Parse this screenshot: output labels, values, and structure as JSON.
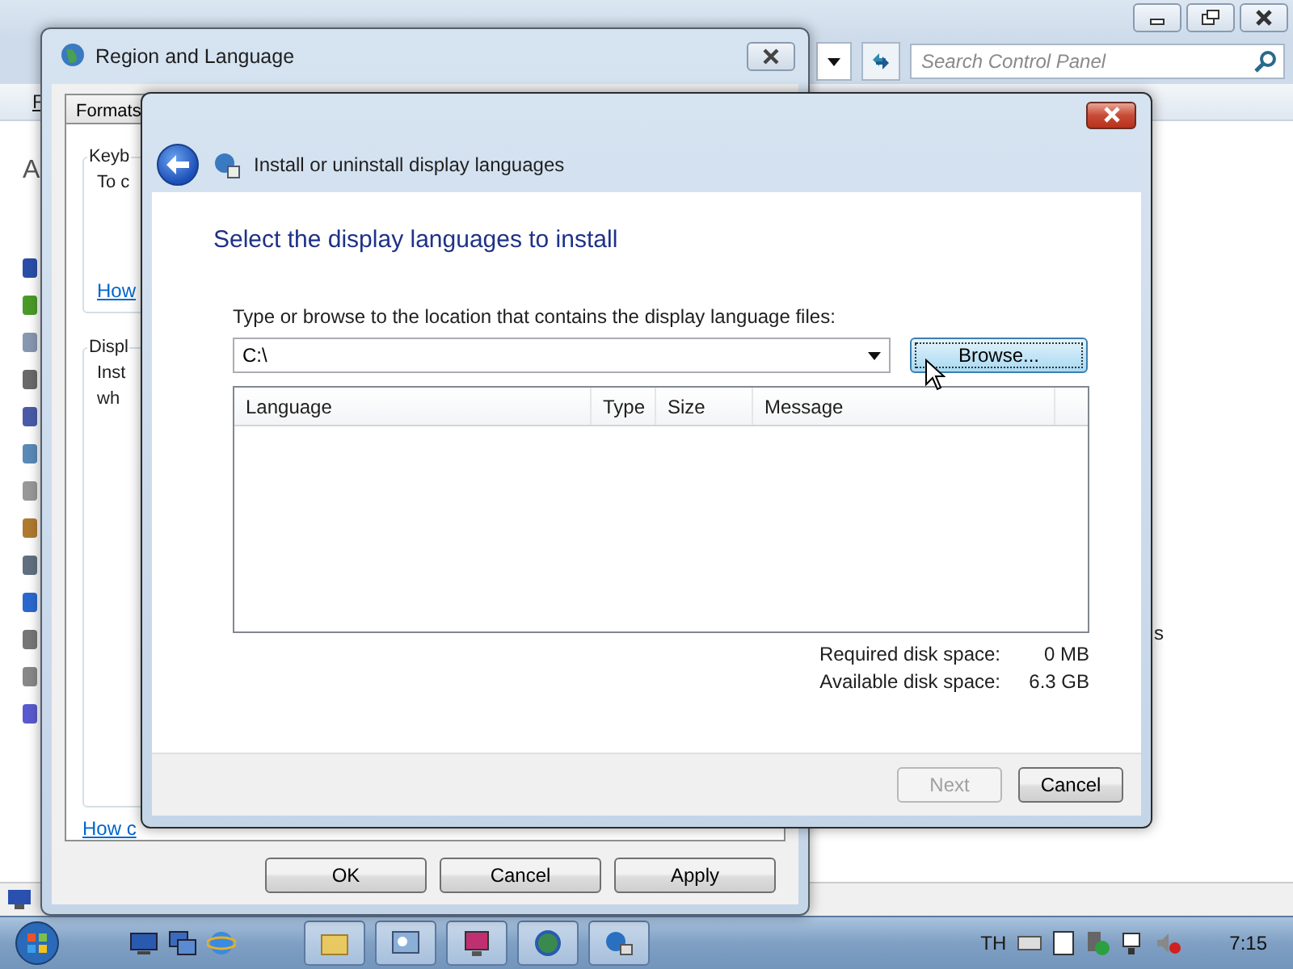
{
  "control_panel": {
    "search": {
      "placeholder": "Search Control Panel"
    },
    "menu_partial": "F",
    "content_partial": "A",
    "right_partial": "s"
  },
  "region_window": {
    "title": "Region and Language",
    "tabs": [
      {
        "label": "Formats",
        "selected": false
      }
    ],
    "groups": [
      {
        "title": "Keyb",
        "lines": [
          "To c"
        ],
        "link": "How"
      },
      {
        "title": "Displ",
        "lines": [
          "Inst",
          "wh"
        ]
      }
    ],
    "link": "How c",
    "buttons": [
      {
        "label": "OK",
        "disabled": false
      },
      {
        "label": "Cancel",
        "disabled": false
      },
      {
        "label": "Apply",
        "disabled": false
      }
    ]
  },
  "install_dialog": {
    "title": "Install or uninstall display languages",
    "heading": "Select the display languages to install",
    "prompt": "Type or browse to the location that contains the display language files:",
    "location": {
      "value": "C:\\"
    },
    "browse_button": "Browse...",
    "table": {
      "columns": [
        "Language",
        "Type",
        "Size",
        "Message"
      ]
    },
    "disk": [
      {
        "label": "Required disk space:",
        "value": "0 MB"
      },
      {
        "label": "Available disk space:",
        "value": "6.3 GB"
      }
    ],
    "buttons": [
      {
        "label": "Next",
        "disabled": true
      },
      {
        "label": "Cancel",
        "disabled": false
      }
    ]
  },
  "taskbar": {
    "language": "TH",
    "clock": "7:15"
  }
}
